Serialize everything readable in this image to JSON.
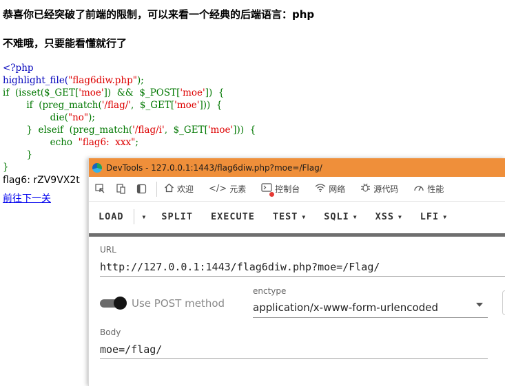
{
  "page": {
    "heading1": "恭喜你已经突破了前端的限制，可以来看一个经典的后端语言：php",
    "heading2": "不难哦，只要能看懂就行了",
    "code": {
      "l1_tag": "<?php",
      "l2_a": "highlight_file(",
      "l2_s": "\"flag6diw.php\"",
      "l2_b": ");",
      "l3_a": "if  (isset($_GET[",
      "l3_s1": "'moe'",
      "l3_b": "])  &&  $_POST[",
      "l3_s2": "'moe'",
      "l3_c": "])  {",
      "l4_a": "        if  (preg_match(",
      "l4_s1": "'/flag/'",
      "l4_b": ",  $_GET[",
      "l4_s2": "'moe'",
      "l4_c": "]))  {",
      "l5_a": "                die(",
      "l5_s": "\"no\"",
      "l5_b": ");",
      "l6_a": "        }  elseif  (preg_match(",
      "l6_s1": "'/flag/i'",
      "l6_b": ",  $_GET[",
      "l6_s2": "'moe'",
      "l6_c": "]))  {",
      "l7_a": "                echo  ",
      "l7_s": "\"flag6:  xxx\"",
      "l7_b": ";",
      "l8": "        }",
      "l9": "}"
    },
    "flag_output": "flag6: rZV9VX2t",
    "next_link": "前往下一关"
  },
  "devtools": {
    "title": "DevTools - 127.0.0.1:1443/flag6diw.php?moe=/Flag/",
    "tabs": [
      {
        "label": "欢迎",
        "icon": "home-icon"
      },
      {
        "label": "元素",
        "icon": "code-icon"
      },
      {
        "label": "控制台",
        "icon": "console-icon"
      },
      {
        "label": "网络",
        "icon": "wifi-icon"
      },
      {
        "label": "源代码",
        "icon": "bug-icon"
      },
      {
        "label": "性能",
        "icon": "gauge-icon"
      }
    ]
  },
  "hackbar": {
    "menu": {
      "load": "LOAD",
      "split": "SPLIT",
      "execute": "EXECUTE",
      "test": "TEST",
      "sqli": "SQLI",
      "xss": "XSS",
      "lfi": "LFI"
    },
    "url_label": "URL",
    "url_value": "http://127.0.0.1:1443/flag6diw.php?moe=/Flag/",
    "post_toggle_label": "Use POST method",
    "post_enabled": true,
    "enctype_label": "enctype",
    "enctype_value": "application/x-www-form-urlencoded",
    "body_label": "Body",
    "body_value": "moe=/flag/"
  },
  "colors": {
    "titlebar": "#ef8f3a",
    "php_keyword": "#007700",
    "php_string": "#dd0000",
    "php_tag": "#0000bb",
    "link": "#0000ee"
  }
}
